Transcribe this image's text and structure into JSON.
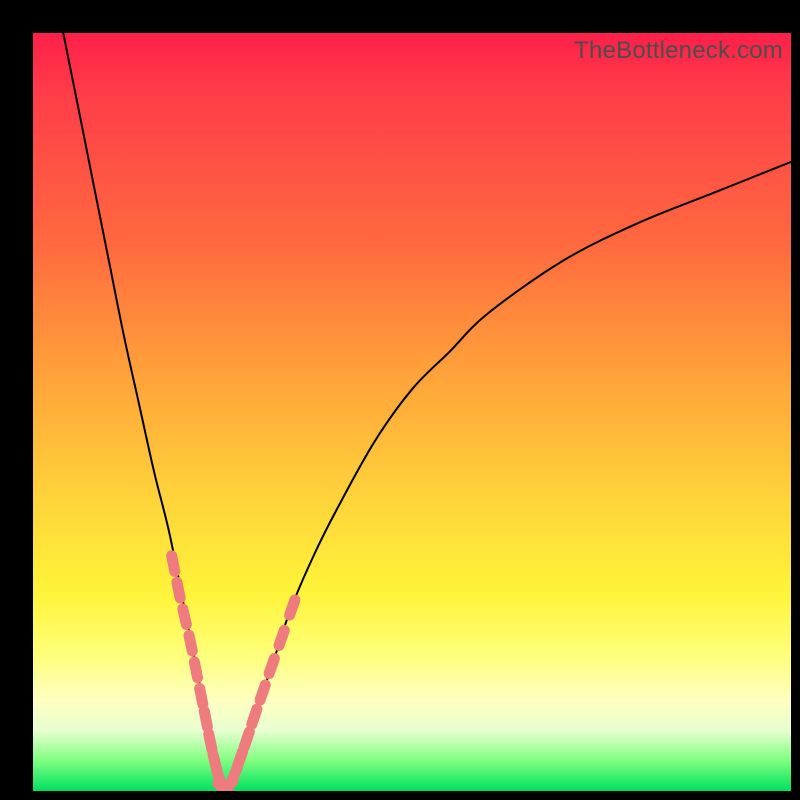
{
  "watermark": "TheBottleneck.com",
  "colors": {
    "frame": "#000000",
    "marker": "#ee7b7d",
    "curve": "#000000",
    "gradient_stops": [
      "#ff1f49",
      "#ff6a3f",
      "#ffd53a",
      "#ffff7a",
      "#00e060"
    ]
  },
  "chart_data": {
    "type": "line",
    "title": "",
    "xlabel": "",
    "ylabel": "",
    "xlim": [
      0,
      100
    ],
    "ylim": [
      0,
      100
    ],
    "note": "Axes are unlabeled; x and y are normalized 0–100. The curve is V-shaped with its minimum near x≈25, y≈0; left branch rises steeply to y≈100 at x≈4, right branch rises to y≈83 at x=100. Background color encodes y from green (y≈0) to red (y≈100). Salmon markers highlight curve points in the low-y region (roughly y < 30).",
    "series": [
      {
        "name": "curve",
        "x": [
          4,
          6,
          8,
          10,
          12,
          14,
          16,
          18,
          20,
          21,
          22,
          23,
          24,
          25,
          26,
          27,
          28,
          29,
          30,
          32,
          34,
          37,
          40,
          45,
          50,
          55,
          60,
          70,
          80,
          90,
          100
        ],
        "y": [
          100,
          90,
          80,
          70,
          60,
          51,
          42,
          34,
          24,
          19,
          14,
          9,
          4,
          1,
          0,
          2,
          5,
          8,
          12,
          18,
          24,
          31,
          37,
          46,
          53,
          58,
          63,
          70,
          75,
          79,
          83
        ]
      }
    ],
    "markers": {
      "name": "highlight-points",
      "x": [
        18.5,
        19.2,
        20.0,
        20.8,
        21.5,
        22.2,
        22.8,
        23.4,
        24.0,
        24.6,
        25.2,
        25.8,
        26.5,
        27.3,
        28.2,
        29.2,
        30.3,
        31.5,
        32.8,
        34.2
      ],
      "y": [
        30.0,
        26.5,
        23.0,
        19.5,
        16.0,
        12.5,
        9.5,
        6.5,
        3.8,
        1.6,
        0.3,
        0.6,
        2.0,
        4.2,
        6.8,
        9.8,
        13.0,
        16.5,
        20.2,
        24.2
      ]
    }
  }
}
